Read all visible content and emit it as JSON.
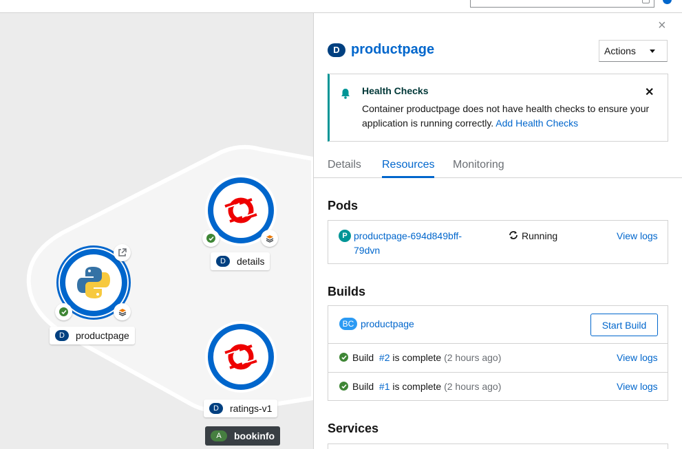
{
  "topology": {
    "nodes": [
      {
        "kind_badge": "D",
        "name": "productpage",
        "runtime_icon": "python-icon"
      },
      {
        "kind_badge": "D",
        "name": "details",
        "runtime_icon": "openshift-icon"
      },
      {
        "kind_badge": "D",
        "name": "ratings-v1",
        "runtime_icon": "openshift-icon"
      }
    ],
    "application_group": {
      "badge": "A",
      "name": "bookinfo"
    }
  },
  "panel": {
    "close_icon": "×",
    "kind_badge": "D",
    "title": "productpage",
    "actions_label": "Actions",
    "alert": {
      "title": "Health Checks",
      "body": "Container productpage does not have health checks to ensure your application is running correctly.",
      "link": "Add Health Checks",
      "close_icon": "✕"
    },
    "tabs": [
      {
        "label": "Details",
        "active": false
      },
      {
        "label": "Resources",
        "active": true
      },
      {
        "label": "Monitoring",
        "active": false
      }
    ],
    "pods": {
      "heading": "Pods",
      "items": [
        {
          "badge": "P",
          "name_line1": "productpage-694d849bff-",
          "name_line2": "79dvn",
          "status": "Running",
          "logs_link": "View logs"
        }
      ]
    },
    "builds": {
      "heading": "Builds",
      "config": {
        "badge": "BC",
        "name": "productpage",
        "start_label": "Start Build"
      },
      "items": [
        {
          "prefix": "Build",
          "number": "#2",
          "suffix": "is complete",
          "age": "(2 hours ago)",
          "logs_link": "View logs"
        },
        {
          "prefix": "Build",
          "number": "#1",
          "suffix": "is complete",
          "age": "(2 hours ago)",
          "logs_link": "View logs"
        }
      ]
    },
    "services": {
      "heading": "Services"
    }
  },
  "colors": {
    "accent": "#0066cc",
    "success": "#3e8635",
    "info": "#009596",
    "badge_dark": "#004080"
  }
}
